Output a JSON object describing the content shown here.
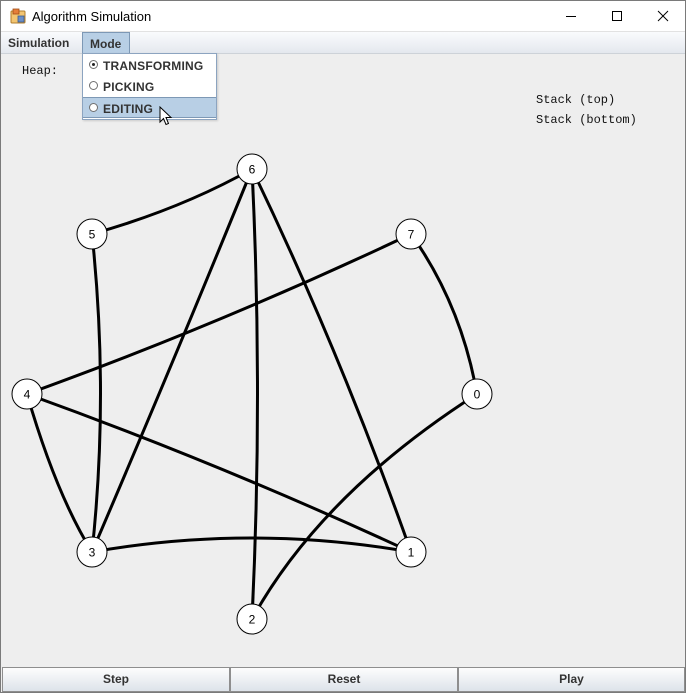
{
  "window": {
    "title": "Algorithm Simulation"
  },
  "menubar": {
    "items": [
      "Simulation",
      "Mode"
    ]
  },
  "mode_menu": {
    "items": [
      {
        "label": "TRANSFORMING",
        "selected": true
      },
      {
        "label": "PICKING",
        "selected": false
      },
      {
        "label": "EDITING",
        "selected": false
      }
    ]
  },
  "labels": {
    "heap": "Heap:",
    "stack_top": "Stack (top)",
    "stack_bottom": "Stack (bottom)"
  },
  "graph": {
    "nodes": [
      "0",
      "1",
      "2",
      "3",
      "4",
      "5",
      "6",
      "7"
    ],
    "edges": [
      [
        "5",
        "6"
      ],
      [
        "5",
        "3"
      ],
      [
        "6",
        "3"
      ],
      [
        "6",
        "2"
      ],
      [
        "6",
        "1"
      ],
      [
        "7",
        "4"
      ],
      [
        "7",
        "0"
      ],
      [
        "4",
        "3"
      ],
      [
        "4",
        "1"
      ],
      [
        "3",
        "1"
      ],
      [
        "0",
        "2"
      ]
    ]
  },
  "buttons": {
    "step": "Step",
    "reset": "Reset",
    "play": "Play"
  },
  "colors": {
    "menu_highlight": "#b8cfe5",
    "canvas_background": "#eeeeee",
    "edge": "#000000"
  }
}
